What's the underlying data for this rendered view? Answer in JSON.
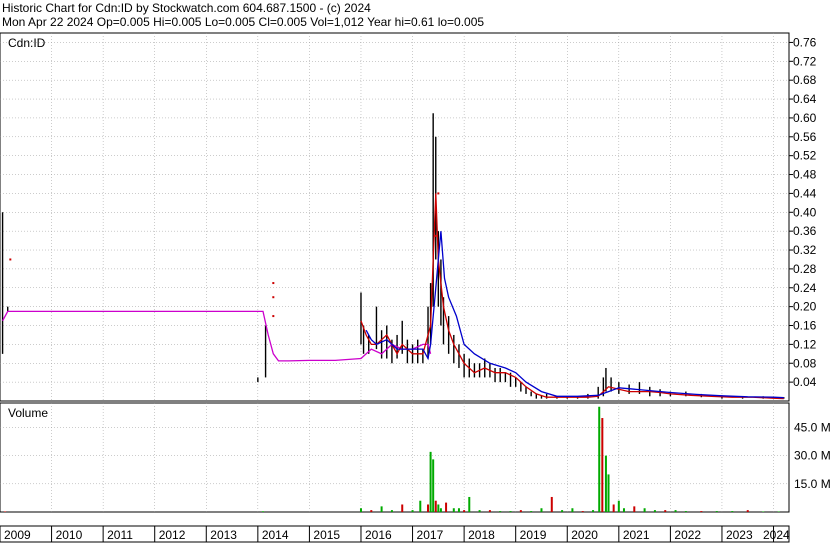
{
  "header": {
    "line1": "Historic Chart for Cdn:ID by Stockwatch.com 604.687.1500 - (c) 2024",
    "line2": "Mon Apr 22 2024   Op=0.005  Hi=0.005  Lo=0.005  Cl=0.005  Vol=1,012  Year hi=0.61  lo=0.005"
  },
  "chart_data": [
    {
      "type": "line",
      "title": "Cdn:ID",
      "y_ticks": [
        "0.76",
        "0.72",
        "0.68",
        "0.64",
        "0.60",
        "0.56",
        "0.52",
        "0.48",
        "0.44",
        "0.40",
        "0.36",
        "0.32",
        "0.28",
        "0.24",
        "0.20",
        "0.16",
        "0.12",
        "0.08",
        "0.04"
      ],
      "ylim": [
        0,
        0.78
      ],
      "xlim": [
        2009.0,
        2024.3
      ],
      "grid": true,
      "series": [
        {
          "role": "moving-average-long",
          "color": "#cc00cc",
          "points": [
            [
              2009.05,
              0.17
            ],
            [
              2009.15,
              0.19
            ],
            [
              2009.4,
              0.19
            ],
            [
              2014.0,
              0.19
            ],
            [
              2014.1,
              0.19
            ],
            [
              2014.2,
              0.14
            ],
            [
              2014.3,
              0.1
            ],
            [
              2014.4,
              0.085
            ],
            [
              2014.6,
              0.085
            ],
            [
              2015.0,
              0.086
            ],
            [
              2015.5,
              0.086
            ],
            [
              2016.0,
              0.09
            ],
            [
              2016.2,
              0.11
            ],
            [
              2016.4,
              0.1
            ],
            [
              2016.6,
              0.12
            ],
            [
              2016.8,
              0.11
            ],
            [
              2017.0,
              0.11
            ],
            [
              2017.2,
              0.12
            ],
            [
              2017.3,
              0.12
            ],
            [
              2017.35,
              0.1
            ]
          ]
        },
        {
          "role": "moving-average-short",
          "color": "#cc0000",
          "points": [
            [
              2016.0,
              0.17
            ],
            [
              2016.1,
              0.14
            ],
            [
              2016.2,
              0.12
            ],
            [
              2016.3,
              0.12
            ],
            [
              2016.4,
              0.13
            ],
            [
              2016.5,
              0.14
            ],
            [
              2016.6,
              0.12
            ],
            [
              2016.7,
              0.1
            ],
            [
              2016.8,
              0.12
            ],
            [
              2016.9,
              0.11
            ],
            [
              2017.0,
              0.1
            ],
            [
              2017.1,
              0.1
            ],
            [
              2017.2,
              0.1
            ],
            [
              2017.35,
              0.16
            ],
            [
              2017.4,
              0.3
            ],
            [
              2017.45,
              0.44
            ],
            [
              2017.5,
              0.3
            ],
            [
              2017.6,
              0.2
            ],
            [
              2017.7,
              0.15
            ],
            [
              2017.8,
              0.12
            ],
            [
              2017.9,
              0.1
            ],
            [
              2018.0,
              0.08
            ],
            [
              2018.2,
              0.06
            ],
            [
              2018.4,
              0.07
            ],
            [
              2018.6,
              0.06
            ],
            [
              2018.8,
              0.06
            ],
            [
              2019.0,
              0.05
            ],
            [
              2019.2,
              0.03
            ],
            [
              2019.4,
              0.015
            ],
            [
              2019.6,
              0.008
            ],
            [
              2019.8,
              0.008
            ],
            [
              2020.0,
              0.008
            ],
            [
              2020.4,
              0.008
            ],
            [
              2020.6,
              0.01
            ],
            [
              2020.7,
              0.02
            ],
            [
              2020.8,
              0.03
            ],
            [
              2021.0,
              0.025
            ],
            [
              2021.2,
              0.02
            ],
            [
              2021.4,
              0.02
            ],
            [
              2021.6,
              0.02
            ],
            [
              2021.8,
              0.018
            ],
            [
              2022.0,
              0.015
            ],
            [
              2022.4,
              0.012
            ],
            [
              2022.8,
              0.01
            ],
            [
              2023.2,
              0.008
            ],
            [
              2023.6,
              0.008
            ],
            [
              2024.0,
              0.006
            ],
            [
              2024.2,
              0.005
            ]
          ]
        },
        {
          "role": "moving-average-medium",
          "color": "#0000cc",
          "points": [
            [
              2016.1,
              0.15
            ],
            [
              2016.2,
              0.13
            ],
            [
              2016.3,
              0.12
            ],
            [
              2016.5,
              0.13
            ],
            [
              2016.7,
              0.11
            ],
            [
              2016.9,
              0.11
            ],
            [
              2017.1,
              0.11
            ],
            [
              2017.2,
              0.11
            ],
            [
              2017.3,
              0.09
            ],
            [
              2017.35,
              0.12
            ],
            [
              2017.45,
              0.24
            ],
            [
              2017.5,
              0.3
            ],
            [
              2017.55,
              0.36
            ],
            [
              2017.62,
              0.26
            ],
            [
              2017.7,
              0.22
            ],
            [
              2017.85,
              0.18
            ],
            [
              2018.0,
              0.12
            ],
            [
              2018.2,
              0.1
            ],
            [
              2018.5,
              0.08
            ],
            [
              2018.8,
              0.07
            ],
            [
              2019.0,
              0.06
            ],
            [
              2019.2,
              0.04
            ],
            [
              2019.5,
              0.02
            ],
            [
              2019.8,
              0.01
            ],
            [
              2020.2,
              0.01
            ],
            [
              2020.6,
              0.012
            ],
            [
              2020.8,
              0.02
            ],
            [
              2021.0,
              0.028
            ],
            [
              2021.3,
              0.025
            ],
            [
              2021.6,
              0.022
            ],
            [
              2022.0,
              0.018
            ],
            [
              2022.5,
              0.014
            ],
            [
              2023.0,
              0.011
            ],
            [
              2023.5,
              0.009
            ],
            [
              2024.0,
              0.008
            ],
            [
              2024.2,
              0.007
            ]
          ]
        }
      ],
      "price_bars": [
        [
          2009.05,
          0.4,
          0.1
        ],
        [
          2009.15,
          0.2,
          0.19
        ],
        [
          2014.0,
          0.05,
          0.04
        ],
        [
          2014.15,
          0.16,
          0.05
        ],
        [
          2016.0,
          0.23,
          0.12
        ],
        [
          2016.05,
          0.16,
          0.1
        ],
        [
          2016.15,
          0.14,
          0.1
        ],
        [
          2016.3,
          0.2,
          0.11
        ],
        [
          2016.4,
          0.15,
          0.09
        ],
        [
          2016.5,
          0.16,
          0.09
        ],
        [
          2016.6,
          0.13,
          0.08
        ],
        [
          2016.7,
          0.14,
          0.09
        ],
        [
          2016.8,
          0.17,
          0.1
        ],
        [
          2016.9,
          0.13,
          0.08
        ],
        [
          2017.0,
          0.12,
          0.08
        ],
        [
          2017.1,
          0.13,
          0.08
        ],
        [
          2017.2,
          0.11,
          0.08
        ],
        [
          2017.3,
          0.2,
          0.09
        ],
        [
          2017.35,
          0.25,
          0.12
        ],
        [
          2017.4,
          0.61,
          0.2
        ],
        [
          2017.45,
          0.56,
          0.3
        ],
        [
          2017.5,
          0.36,
          0.2
        ],
        [
          2017.55,
          0.3,
          0.16
        ],
        [
          2017.6,
          0.22,
          0.12
        ],
        [
          2017.7,
          0.18,
          0.1
        ],
        [
          2017.8,
          0.14,
          0.08
        ],
        [
          2017.9,
          0.12,
          0.07
        ],
        [
          2018.0,
          0.1,
          0.05
        ],
        [
          2018.1,
          0.09,
          0.05
        ],
        [
          2018.2,
          0.08,
          0.05
        ],
        [
          2018.3,
          0.08,
          0.05
        ],
        [
          2018.4,
          0.09,
          0.05
        ],
        [
          2018.5,
          0.08,
          0.05
        ],
        [
          2018.6,
          0.07,
          0.04
        ],
        [
          2018.7,
          0.07,
          0.04
        ],
        [
          2018.8,
          0.06,
          0.04
        ],
        [
          2018.9,
          0.06,
          0.03
        ],
        [
          2019.0,
          0.05,
          0.03
        ],
        [
          2019.1,
          0.04,
          0.02
        ],
        [
          2019.2,
          0.03,
          0.015
        ],
        [
          2019.3,
          0.02,
          0.01
        ],
        [
          2019.4,
          0.015,
          0.005
        ],
        [
          2019.5,
          0.012,
          0.005
        ],
        [
          2019.6,
          0.015,
          0.005
        ],
        [
          2019.8,
          0.01,
          0.005
        ],
        [
          2020.0,
          0.01,
          0.005
        ],
        [
          2020.2,
          0.01,
          0.005
        ],
        [
          2020.4,
          0.015,
          0.005
        ],
        [
          2020.6,
          0.03,
          0.005
        ],
        [
          2020.7,
          0.05,
          0.01
        ],
        [
          2020.75,
          0.07,
          0.02
        ],
        [
          2020.85,
          0.05,
          0.02
        ],
        [
          2021.0,
          0.04,
          0.015
        ],
        [
          2021.2,
          0.035,
          0.015
        ],
        [
          2021.4,
          0.04,
          0.015
        ],
        [
          2021.6,
          0.03,
          0.01
        ],
        [
          2021.8,
          0.025,
          0.01
        ],
        [
          2022.0,
          0.02,
          0.01
        ],
        [
          2022.3,
          0.02,
          0.01
        ],
        [
          2022.6,
          0.015,
          0.008
        ],
        [
          2023.0,
          0.012,
          0.005
        ],
        [
          2023.4,
          0.01,
          0.005
        ],
        [
          2023.8,
          0.01,
          0.005
        ],
        [
          2024.2,
          0.008,
          0.005
        ]
      ],
      "close_markers": [
        [
          2009.2,
          0.3
        ],
        [
          2014.3,
          0.25
        ],
        [
          2014.3,
          0.22
        ],
        [
          2014.3,
          0.18
        ],
        [
          2017.45,
          0.35
        ],
        [
          2017.5,
          0.44
        ]
      ]
    },
    {
      "type": "bar",
      "title": "Volume",
      "y_ticks": [
        "45.0 M",
        "30.0 M",
        "15.0 M"
      ],
      "ylim": [
        0,
        58
      ],
      "bars": [
        [
          2009.1,
          0.3
        ],
        [
          2014.1,
          0.4
        ],
        [
          2016.0,
          2
        ],
        [
          2016.2,
          1
        ],
        [
          2016.4,
          3
        ],
        [
          2016.6,
          1
        ],
        [
          2016.8,
          4
        ],
        [
          2017.0,
          1
        ],
        [
          2017.15,
          6
        ],
        [
          2017.3,
          4
        ],
        [
          2017.35,
          32
        ],
        [
          2017.4,
          28
        ],
        [
          2017.45,
          6
        ],
        [
          2017.5,
          4
        ],
        [
          2017.55,
          2
        ],
        [
          2017.65,
          5
        ],
        [
          2017.8,
          2
        ],
        [
          2017.9,
          2
        ],
        [
          2018.0,
          1
        ],
        [
          2018.1,
          8
        ],
        [
          2018.3,
          1
        ],
        [
          2018.5,
          1
        ],
        [
          2018.7,
          0.5
        ],
        [
          2018.9,
          0.5
        ],
        [
          2019.1,
          1
        ],
        [
          2019.3,
          0.5
        ],
        [
          2019.5,
          2
        ],
        [
          2019.7,
          8
        ],
        [
          2019.9,
          1
        ],
        [
          2020.1,
          2
        ],
        [
          2020.3,
          0.5
        ],
        [
          2020.5,
          1
        ],
        [
          2020.62,
          56
        ],
        [
          2020.68,
          50
        ],
        [
          2020.75,
          30
        ],
        [
          2020.8,
          20
        ],
        [
          2020.9,
          4
        ],
        [
          2021.0,
          6
        ],
        [
          2021.1,
          2
        ],
        [
          2021.3,
          3
        ],
        [
          2021.5,
          2
        ],
        [
          2021.7,
          1
        ],
        [
          2021.9,
          1
        ],
        [
          2022.1,
          1
        ],
        [
          2022.3,
          0.5
        ],
        [
          2022.6,
          0.5
        ],
        [
          2022.9,
          0.5
        ],
        [
          2023.2,
          0.5
        ],
        [
          2023.5,
          1
        ],
        [
          2023.8,
          0.3
        ],
        [
          2024.1,
          0.3
        ]
      ]
    }
  ],
  "x_axis": {
    "labels": [
      "2009",
      "2010",
      "2011",
      "2012",
      "2013",
      "2014",
      "2015",
      "2016",
      "2017",
      "2018",
      "2019",
      "2020",
      "2021",
      "2022",
      "2023",
      "2024"
    ]
  },
  "colors": {
    "background": "#ffffff",
    "grid": "#999999",
    "price_bar": "#000000",
    "short_ma": "#cc0000",
    "long_ma": "#cc00cc",
    "medium_ma": "#0000cc",
    "volume_up": "#00aa00",
    "volume_down": "#cc0000",
    "axis_bg": "#ffffff"
  }
}
